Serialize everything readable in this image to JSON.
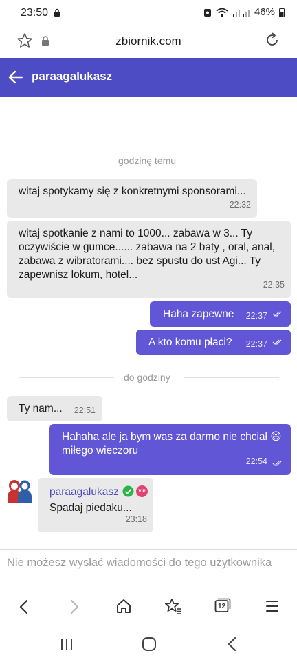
{
  "status_bar": {
    "time": "23:50",
    "battery": "46%"
  },
  "browser": {
    "url": "zbiornik.com",
    "tabs_count": "12"
  },
  "header": {
    "title": "paraagalukasz"
  },
  "dividers": [
    "godzinę temu",
    "do godziny"
  ],
  "messages": [
    {
      "text": "witaj spotykamy się z konkretnymi sponsorami...",
      "time": "22:32",
      "direction": "incoming"
    },
    {
      "text": "witaj spotkanie z nami to 1000... zabawa w 3... Ty oczywiście w gumce...... zabawa na 2 baty , oral, anal, zabawa z wibratorami.... bez spustu do ust Agi... Ty zapewnisz lokum, hotel...",
      "time": "22:35",
      "direction": "incoming"
    },
    {
      "text": "Haha zapewne",
      "time": "22:37",
      "direction": "outgoing"
    },
    {
      "text": "A kto komu płaci?",
      "time": "22:37",
      "direction": "outgoing"
    },
    {
      "text": "Ty nam...",
      "time": "22:51",
      "direction": "incoming"
    },
    {
      "text": "Hahaha ale ja bym was za darmo nie chciał 😄 miłego wieczoru",
      "time": "22:54",
      "direction": "outgoing"
    },
    {
      "sender": "paraagalukasz",
      "badge": "VIP",
      "text": "Spadaj piedaku...",
      "time": "23:18",
      "direction": "incoming"
    }
  ],
  "composer": {
    "notice": "Nie możesz wysłać wiadomości do tego użytkownika"
  },
  "colors": {
    "header": "#4e4cc5",
    "outgoing_bubble": "#6156d5",
    "incoming_bubble": "#e9e9ea",
    "verified": "#2cb34a",
    "vip": "#e0436f"
  }
}
